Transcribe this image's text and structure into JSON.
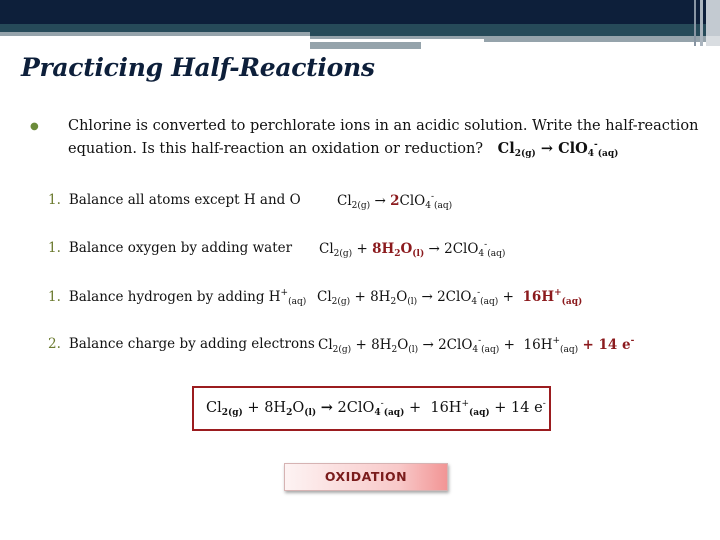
{
  "slide": {
    "title": "Practicing Half-Reactions",
    "intro": {
      "text": "Chlorine is converted to perchlorate ions in an acidic solution.  Write the half-reaction equation.  Is this half-reaction an oxidation or reduction?",
      "eq_reactant": "Cl",
      "eq_reactant_sub": "2(g)",
      "eq_arrow": "→",
      "eq_product": "ClO",
      "eq_product_sub": "4",
      "eq_product_sup": "-",
      "eq_product_state": "(aq)"
    },
    "steps": [
      {
        "number": "1.",
        "label": "Balance all atoms except H and O",
        "equation": {
          "cl": "Cl",
          "cl_sub": "2(g)",
          "arrow": "→",
          "coef": "2",
          "clo": "ClO",
          "clo_sub": "4",
          "clo_sup": "-",
          "clo_state": "(aq)"
        }
      },
      {
        "number": "1.",
        "label": "Balance oxygen by adding water",
        "equation": {
          "cl": "Cl",
          "cl_sub": "2(g)",
          "plus": "+",
          "water": "8H",
          "water_sub": "2",
          "water_o": "O",
          "water_state": "(l)",
          "arrow": "→",
          "clo": "2ClO",
          "clo_sub": "4",
          "clo_sup": "-",
          "clo_state": "(aq)"
        }
      },
      {
        "number": "1.",
        "label": "Balance hydrogen by adding H",
        "label_sup": "+",
        "label_sub": "(aq)",
        "equation": {
          "cl": "Cl",
          "cl_sub": "2(g)",
          "plus": "+",
          "water": "8H",
          "water_sub": "2",
          "water_o": "O",
          "water_state": "(l)",
          "arrow": "→",
          "clo": "2ClO",
          "clo_sub": "4",
          "clo_sup": "-",
          "clo_state": "(aq)",
          "plus2": "+",
          "h": "16H",
          "h_sup": "+",
          "h_state": "(aq)"
        }
      },
      {
        "number": "2.",
        "label": "Balance charge by adding electrons",
        "equation": {
          "cl": "Cl",
          "cl_sub": "2(g)",
          "plus": "+",
          "water": "8H",
          "water_sub": "2",
          "water_o": "O",
          "water_state": "(l)",
          "arrow": "→",
          "clo": "2ClO",
          "clo_sub": "4",
          "clo_sup": "-",
          "clo_state": "(aq)",
          "plus2": "+",
          "h": "16H",
          "h_sup": "+",
          "h_state": "(aq)",
          "e": "+ 14 e",
          "e_sup": "-"
        }
      }
    ],
    "final_equation": {
      "cl": "Cl",
      "cl_sub": "2(g)",
      "plus": "+",
      "water": "8H",
      "water_sub": "2",
      "water_o": "O",
      "water_state": "(l)",
      "arrow": "→",
      "clo": "2ClO",
      "clo_sub": "4",
      "clo_sup": "-",
      "clo_state": "(aq)",
      "plus2": "+",
      "h": "16H",
      "h_sup": "+",
      "h_state": "(aq)",
      "plus3": "+",
      "e": "14 e",
      "e_sup": "-"
    },
    "answer": "OXIDATION",
    "colors": {
      "header_navy": "#0d1f3a",
      "header_teal": "#264a59",
      "accent_red": "#8b1a1d",
      "box_border": "#9b1c1f",
      "number_olive": "#6b7a2f"
    }
  }
}
